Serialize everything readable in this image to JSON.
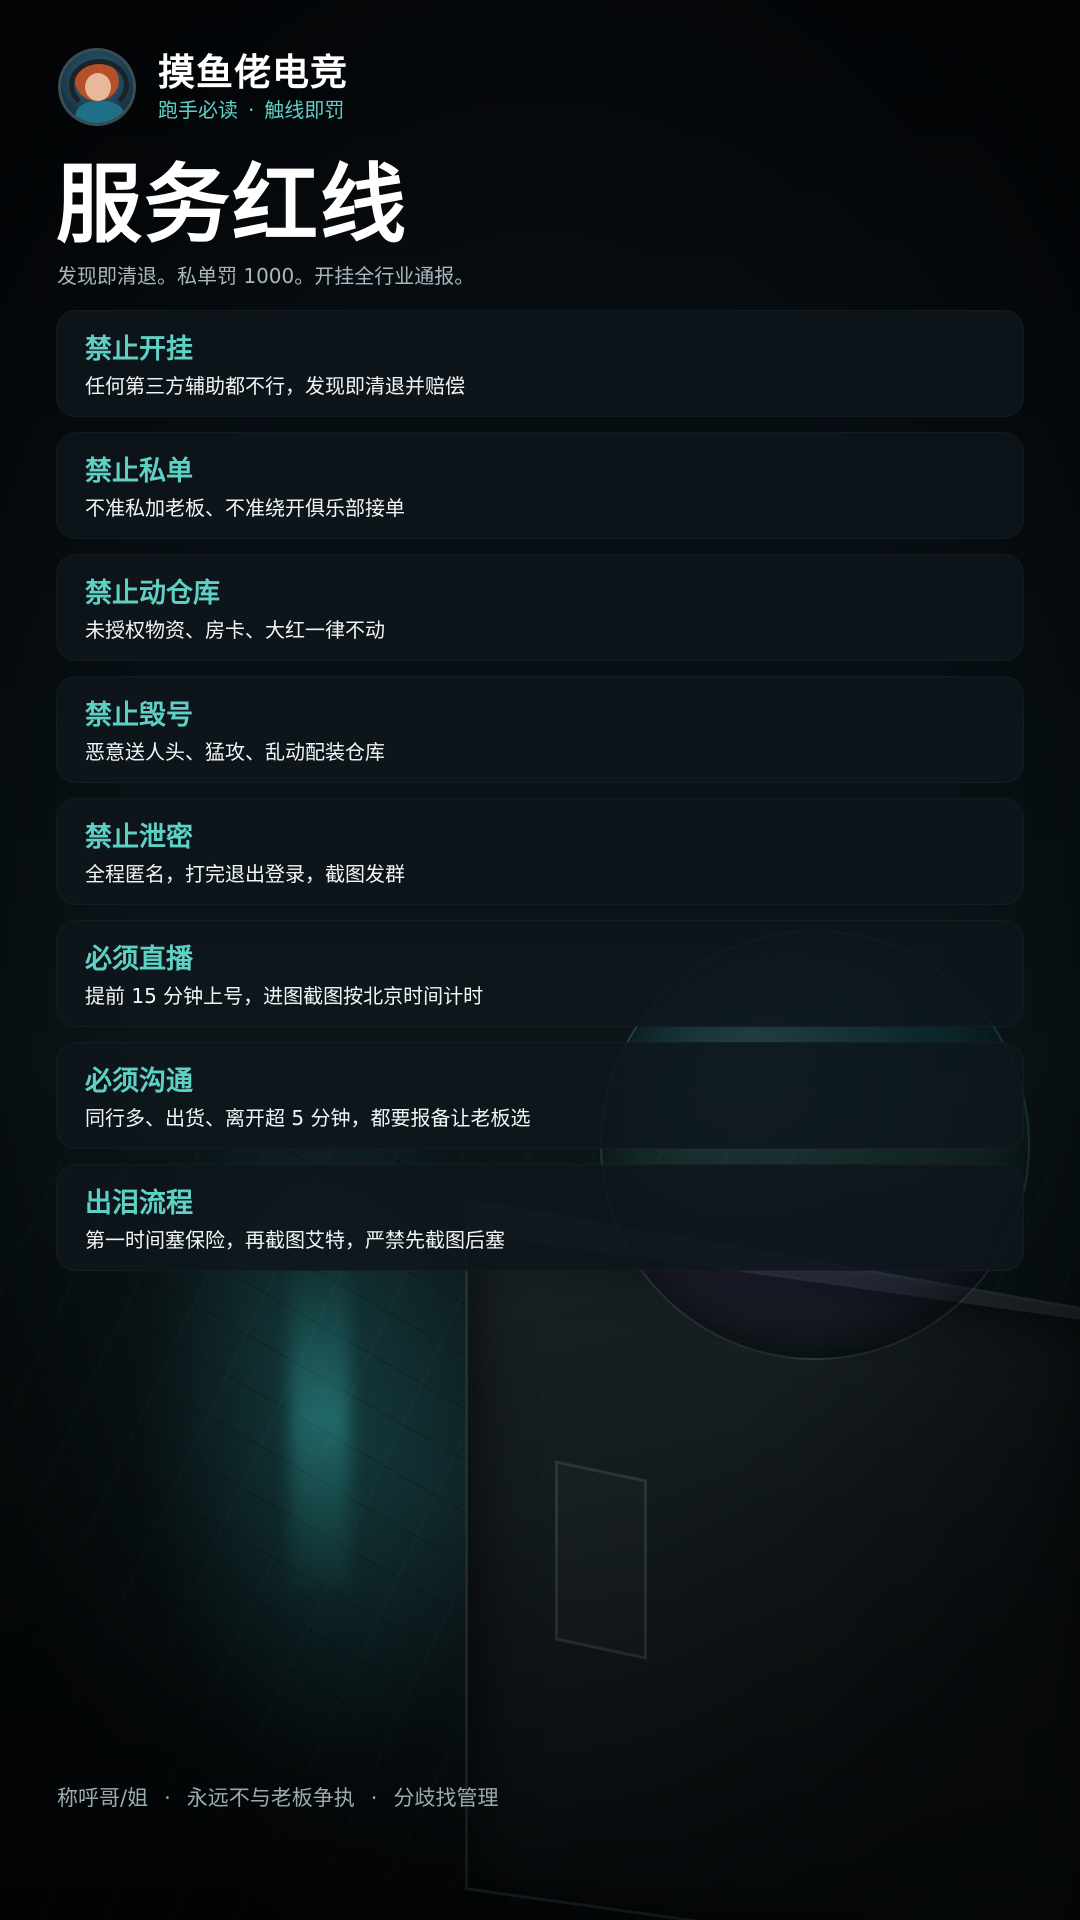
{
  "header": {
    "brand_name": "摸鱼佬电竞",
    "tagline_left": "跑手必读",
    "tagline_sep": "·",
    "tagline_right": "触线即罚"
  },
  "title": "服务红线",
  "subtitle": "发现即清退。私单罚 1000。开挂全行业通报。",
  "rules": [
    {
      "title": "禁止开挂",
      "desc": "任何第三方辅助都不行，发现即清退并赔偿"
    },
    {
      "title": "禁止私单",
      "desc": "不准私加老板、不准绕开俱乐部接单"
    },
    {
      "title": "禁止动仓库",
      "desc": "未授权物资、房卡、大红一律不动"
    },
    {
      "title": "禁止毁号",
      "desc": "恶意送人头、猛攻、乱动配装仓库"
    },
    {
      "title": "禁止泄密",
      "desc": "全程匿名，打完退出登录，截图发群"
    },
    {
      "title": "必须直播",
      "desc": "提前 15 分钟上号，进图截图按北京时间计时"
    },
    {
      "title": "必须沟通",
      "desc": "同行多、出货、离开超 5 分钟，都要报备让老板选"
    },
    {
      "title": "出泪流程",
      "desc": "第一时间塞保险，再截图艾特，严禁先截图后塞"
    }
  ],
  "footer": {
    "item1": "称呼哥/姐",
    "item2": "永远不与老板争执",
    "item3": "分歧找管理",
    "sep": "·"
  },
  "colors": {
    "accent": "#5fd0c4",
    "card_bg": "#0e161c",
    "background": "#05090c"
  }
}
